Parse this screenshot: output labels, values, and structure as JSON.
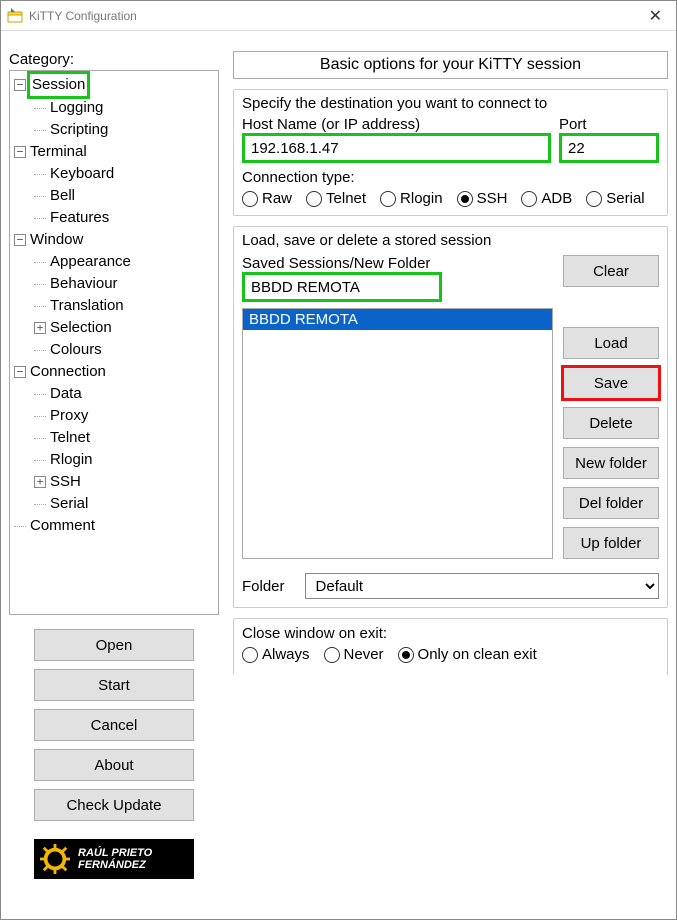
{
  "title": "KiTTY Configuration",
  "category_label": "Category:",
  "tree": [
    {
      "label": "Session",
      "depth": 0,
      "toggle": "-",
      "highlight": true
    },
    {
      "label": "Logging",
      "depth": 1
    },
    {
      "label": "Scripting",
      "depth": 1
    },
    {
      "label": "Terminal",
      "depth": 0,
      "toggle": "-"
    },
    {
      "label": "Keyboard",
      "depth": 1
    },
    {
      "label": "Bell",
      "depth": 1
    },
    {
      "label": "Features",
      "depth": 1
    },
    {
      "label": "Window",
      "depth": 0,
      "toggle": "-"
    },
    {
      "label": "Appearance",
      "depth": 1
    },
    {
      "label": "Behaviour",
      "depth": 1
    },
    {
      "label": "Translation",
      "depth": 1
    },
    {
      "label": "Selection",
      "depth": 1,
      "toggle": "+"
    },
    {
      "label": "Colours",
      "depth": 1
    },
    {
      "label": "Connection",
      "depth": 0,
      "toggle": "-"
    },
    {
      "label": "Data",
      "depth": 1
    },
    {
      "label": "Proxy",
      "depth": 1
    },
    {
      "label": "Telnet",
      "depth": 1
    },
    {
      "label": "Rlogin",
      "depth": 1
    },
    {
      "label": "SSH",
      "depth": 1,
      "toggle": "+"
    },
    {
      "label": "Serial",
      "depth": 1
    },
    {
      "label": "Comment",
      "depth": 0
    }
  ],
  "left_buttons": {
    "open": "Open",
    "start": "Start",
    "cancel": "Cancel",
    "about": "About",
    "check": "Check Update"
  },
  "logo": {
    "line1": "RAÚL PRIETO",
    "line2": "FERNÁNDEZ"
  },
  "panel_title": "Basic options for your KiTTY session",
  "dest": {
    "group": "Specify the destination you want to connect to",
    "host_label": "Host Name (or IP address)",
    "host_value": "192.168.1.47",
    "port_label": "Port",
    "port_value": "22",
    "conn_label": "Connection type:",
    "opts": [
      "Raw",
      "Telnet",
      "Rlogin",
      "SSH",
      "ADB",
      "Serial"
    ],
    "selected": "SSH"
  },
  "sess": {
    "group": "Load, save or delete a stored session",
    "label": "Saved Sessions/New Folder",
    "value": "BBDD REMOTA",
    "items": [
      "BBDD REMOTA"
    ],
    "selected": "BBDD REMOTA",
    "btns": {
      "clear": "Clear",
      "load": "Load",
      "save": "Save",
      "delete": "Delete",
      "newf": "New folder",
      "delf": "Del folder",
      "upf": "Up folder"
    },
    "folder_label": "Folder",
    "folder_value": "Default"
  },
  "close": {
    "label": "Close window on exit:",
    "opts": [
      "Always",
      "Never",
      "Only on clean exit"
    ],
    "selected": "Only on clean exit"
  }
}
